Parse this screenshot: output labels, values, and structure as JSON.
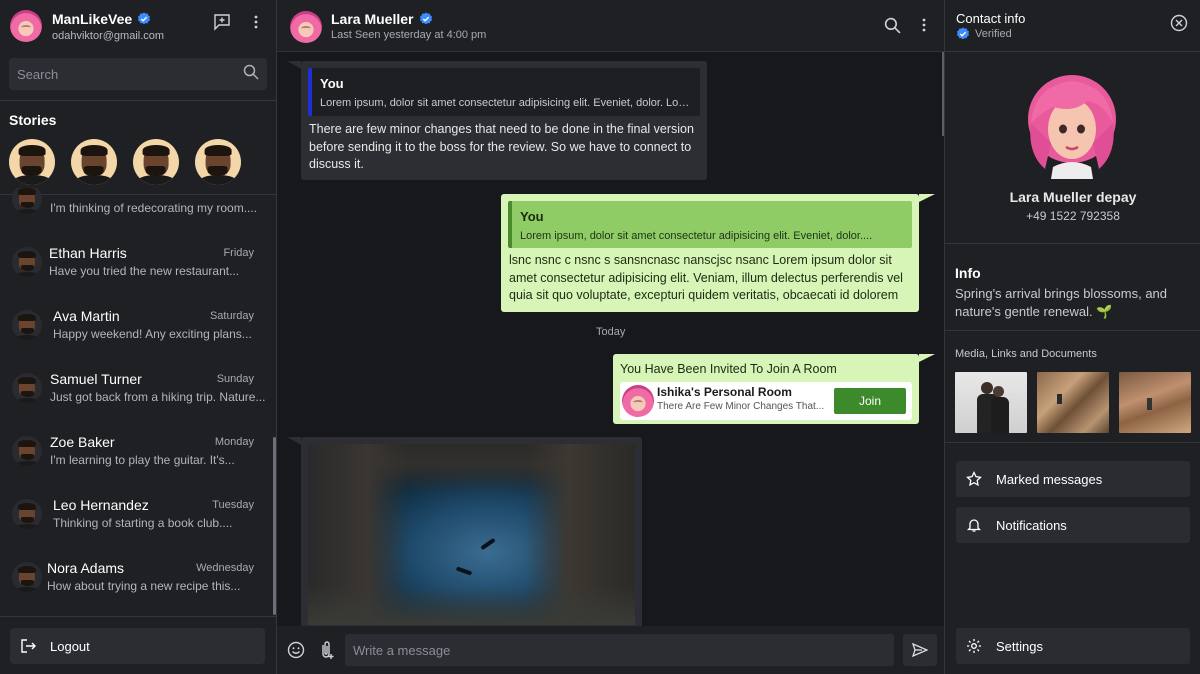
{
  "me": {
    "name": "ManLikeVee",
    "email": "odahviktor@gmail.com"
  },
  "search": {
    "placeholder": "Search"
  },
  "stories": {
    "title": "Stories"
  },
  "chats": [
    {
      "name": "",
      "day": "",
      "preview": "I'm thinking of redecorating my room...."
    },
    {
      "name": "Ethan Harris",
      "day": "Friday",
      "preview": "Have you tried the new restaurant..."
    },
    {
      "name": "Ava Martin",
      "day": "Saturday",
      "preview": "Happy weekend! Any exciting plans..."
    },
    {
      "name": "Samuel Turner",
      "day": "Sunday",
      "preview": "Just got back from a hiking trip. Nature..."
    },
    {
      "name": "Zoe Baker",
      "day": "Monday",
      "preview": "I'm learning to play the guitar. It's..."
    },
    {
      "name": "Leo Hernandez",
      "day": "Tuesday",
      "preview": "Thinking of starting a book club...."
    },
    {
      "name": "Nora Adams",
      "day": "Wednesday",
      "preview": "How about trying a new recipe this..."
    }
  ],
  "logout": {
    "label": "Logout"
  },
  "chat_header": {
    "name": "Lara Mueller",
    "last_seen": "Last Seen yesterday at 4:00 pm"
  },
  "messages": {
    "m1": {
      "quote_title": "You",
      "quote_body": "Lorem ipsum, dolor sit amet consectetur adipisicing elit. Eveniet, dolor. Lorem...",
      "text": "There are few minor changes that need to be done in the final version before sending it to the boss for the review. So we have to connect to discuss it."
    },
    "m2": {
      "quote_title": "You",
      "quote_body": "Lorem ipsum, dolor sit amet consectetur adipisicing elit. Eveniet, dolor....",
      "text": "lsnc nsnc c nsnc s sansncnasc nanscjsc nsanc Lorem ipsum dolor sit amet consectetur adipisicing elit. Veniam, illum delectus perferendis vel quia sit quo voluptate, excepturi quidem veritatis, obcaecati id dolorem"
    },
    "date_divider": "Today",
    "invite": {
      "title": "You Have Been Invited To Join A Room",
      "room_name": "Ishika's Personal Room",
      "room_sub": "There Are Few Minor Changes That...",
      "join_label": "Join"
    }
  },
  "composer": {
    "placeholder": "Write a message"
  },
  "contact": {
    "title": "Contact info",
    "verified": "Verified",
    "name": "Lara Mueller depay",
    "phone": "+49 1522 792358",
    "info_title": "Info",
    "info_text": "Spring's arrival brings blossoms, and nature's gentle renewal. 🌱",
    "media_title": "Media, Links and Documents",
    "marked": "Marked messages",
    "notifications": "Notifications",
    "settings": "Settings"
  },
  "colors": {
    "accent_green": "#3d8a2c",
    "bubble_out": "#d6f5b6",
    "quote_bar_blue": "#1f2fd6",
    "verified_blue": "#3d8bfd"
  },
  "icons": [
    "verified-icon",
    "new-chat-icon",
    "kebab-icon",
    "search-icon",
    "logout-icon",
    "emoji-icon",
    "attach-icon",
    "send-icon",
    "close-icon",
    "star-icon",
    "bell-icon",
    "gear-icon"
  ]
}
